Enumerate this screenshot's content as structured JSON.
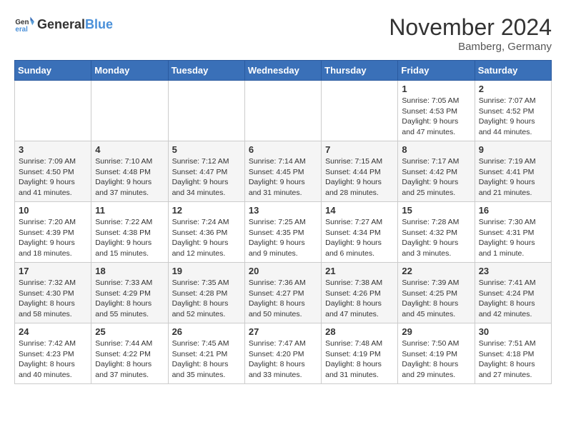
{
  "header": {
    "logo_general": "General",
    "logo_blue": "Blue",
    "month_title": "November 2024",
    "location": "Bamberg, Germany"
  },
  "weekdays": [
    "Sunday",
    "Monday",
    "Tuesday",
    "Wednesday",
    "Thursday",
    "Friday",
    "Saturday"
  ],
  "weeks": [
    [
      {
        "day": "",
        "info": ""
      },
      {
        "day": "",
        "info": ""
      },
      {
        "day": "",
        "info": ""
      },
      {
        "day": "",
        "info": ""
      },
      {
        "day": "",
        "info": ""
      },
      {
        "day": "1",
        "info": "Sunrise: 7:05 AM\nSunset: 4:53 PM\nDaylight: 9 hours and 47 minutes."
      },
      {
        "day": "2",
        "info": "Sunrise: 7:07 AM\nSunset: 4:52 PM\nDaylight: 9 hours and 44 minutes."
      }
    ],
    [
      {
        "day": "3",
        "info": "Sunrise: 7:09 AM\nSunset: 4:50 PM\nDaylight: 9 hours and 41 minutes."
      },
      {
        "day": "4",
        "info": "Sunrise: 7:10 AM\nSunset: 4:48 PM\nDaylight: 9 hours and 37 minutes."
      },
      {
        "day": "5",
        "info": "Sunrise: 7:12 AM\nSunset: 4:47 PM\nDaylight: 9 hours and 34 minutes."
      },
      {
        "day": "6",
        "info": "Sunrise: 7:14 AM\nSunset: 4:45 PM\nDaylight: 9 hours and 31 minutes."
      },
      {
        "day": "7",
        "info": "Sunrise: 7:15 AM\nSunset: 4:44 PM\nDaylight: 9 hours and 28 minutes."
      },
      {
        "day": "8",
        "info": "Sunrise: 7:17 AM\nSunset: 4:42 PM\nDaylight: 9 hours and 25 minutes."
      },
      {
        "day": "9",
        "info": "Sunrise: 7:19 AM\nSunset: 4:41 PM\nDaylight: 9 hours and 21 minutes."
      }
    ],
    [
      {
        "day": "10",
        "info": "Sunrise: 7:20 AM\nSunset: 4:39 PM\nDaylight: 9 hours and 18 minutes."
      },
      {
        "day": "11",
        "info": "Sunrise: 7:22 AM\nSunset: 4:38 PM\nDaylight: 9 hours and 15 minutes."
      },
      {
        "day": "12",
        "info": "Sunrise: 7:24 AM\nSunset: 4:36 PM\nDaylight: 9 hours and 12 minutes."
      },
      {
        "day": "13",
        "info": "Sunrise: 7:25 AM\nSunset: 4:35 PM\nDaylight: 9 hours and 9 minutes."
      },
      {
        "day": "14",
        "info": "Sunrise: 7:27 AM\nSunset: 4:34 PM\nDaylight: 9 hours and 6 minutes."
      },
      {
        "day": "15",
        "info": "Sunrise: 7:28 AM\nSunset: 4:32 PM\nDaylight: 9 hours and 3 minutes."
      },
      {
        "day": "16",
        "info": "Sunrise: 7:30 AM\nSunset: 4:31 PM\nDaylight: 9 hours and 1 minute."
      }
    ],
    [
      {
        "day": "17",
        "info": "Sunrise: 7:32 AM\nSunset: 4:30 PM\nDaylight: 8 hours and 58 minutes."
      },
      {
        "day": "18",
        "info": "Sunrise: 7:33 AM\nSunset: 4:29 PM\nDaylight: 8 hours and 55 minutes."
      },
      {
        "day": "19",
        "info": "Sunrise: 7:35 AM\nSunset: 4:28 PM\nDaylight: 8 hours and 52 minutes."
      },
      {
        "day": "20",
        "info": "Sunrise: 7:36 AM\nSunset: 4:27 PM\nDaylight: 8 hours and 50 minutes."
      },
      {
        "day": "21",
        "info": "Sunrise: 7:38 AM\nSunset: 4:26 PM\nDaylight: 8 hours and 47 minutes."
      },
      {
        "day": "22",
        "info": "Sunrise: 7:39 AM\nSunset: 4:25 PM\nDaylight: 8 hours and 45 minutes."
      },
      {
        "day": "23",
        "info": "Sunrise: 7:41 AM\nSunset: 4:24 PM\nDaylight: 8 hours and 42 minutes."
      }
    ],
    [
      {
        "day": "24",
        "info": "Sunrise: 7:42 AM\nSunset: 4:23 PM\nDaylight: 8 hours and 40 minutes."
      },
      {
        "day": "25",
        "info": "Sunrise: 7:44 AM\nSunset: 4:22 PM\nDaylight: 8 hours and 37 minutes."
      },
      {
        "day": "26",
        "info": "Sunrise: 7:45 AM\nSunset: 4:21 PM\nDaylight: 8 hours and 35 minutes."
      },
      {
        "day": "27",
        "info": "Sunrise: 7:47 AM\nSunset: 4:20 PM\nDaylight: 8 hours and 33 minutes."
      },
      {
        "day": "28",
        "info": "Sunrise: 7:48 AM\nSunset: 4:19 PM\nDaylight: 8 hours and 31 minutes."
      },
      {
        "day": "29",
        "info": "Sunrise: 7:50 AM\nSunset: 4:19 PM\nDaylight: 8 hours and 29 minutes."
      },
      {
        "day": "30",
        "info": "Sunrise: 7:51 AM\nSunset: 4:18 PM\nDaylight: 8 hours and 27 minutes."
      }
    ]
  ]
}
